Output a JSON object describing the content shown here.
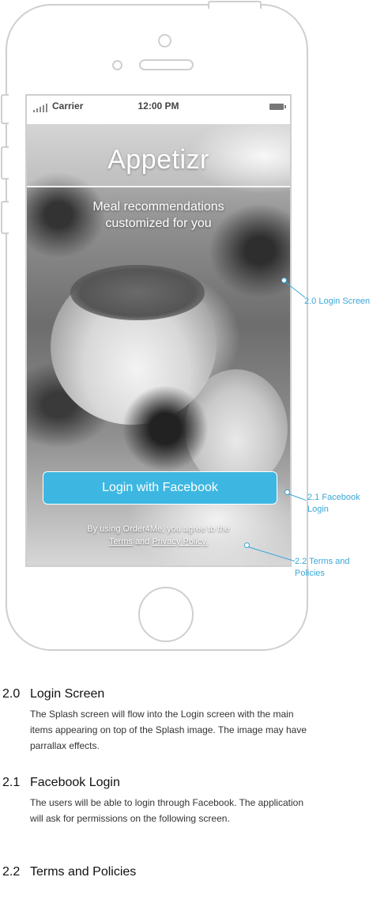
{
  "status_bar": {
    "carrier": "Carrier",
    "time": "12:00 PM"
  },
  "splash": {
    "app_name": "Appetizr",
    "tagline_line1": "Meal recommendations",
    "tagline_line2": "customized for you",
    "login_button": "Login with Facebook",
    "terms_line1": "By using Order4Me, you agree to the",
    "terms_link": "Terms",
    "terms_and": "and",
    "privacy_link": "Privacy Policy."
  },
  "annotations": {
    "login_screen": "2.0 Login Screen",
    "facebook_login_line1": "2.1 Facebook",
    "facebook_login_line2": "Login",
    "terms_line1": "2.2 Terms and",
    "terms_line2": "Policies"
  },
  "accent_color": "#3db7e1",
  "spec": [
    {
      "number": "2.0",
      "title": "Login Screen",
      "body": "The Splash screen will flow into the Login screen with the main items appearing on top of the Splash image. The image may have parrallax effects."
    },
    {
      "number": "2.1",
      "title": "Facebook Login",
      "body": "The users will be able to login through Facebook. The application will ask for permissions on the following screen."
    },
    {
      "number": "2.2",
      "title": "Terms and Policies"
    }
  ]
}
